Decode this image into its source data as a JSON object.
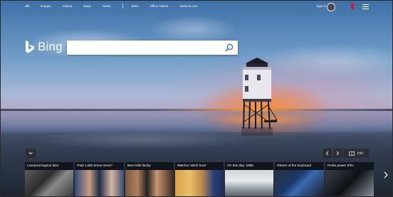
{
  "nav": {
    "links": [
      "All",
      "Images",
      "Videos",
      "Maps",
      "News",
      "MSN",
      "Office Online",
      "Outlook.com"
    ],
    "signin": "Sign in"
  },
  "brand": {
    "logo_text": "Bing"
  },
  "search": {
    "placeholder": "",
    "value": ""
  },
  "carousel": {
    "info_label": "Info",
    "cards": [
      {
        "caption": "Liverpool legend dies",
        "image": "crowd-photo"
      },
      {
        "caption": "Paid 1,500 times more?",
        "image": "two-men-photo"
      },
      {
        "caption": "Mom kills family",
        "image": "sunglasses-photo"
      },
      {
        "caption": "#MeToo 'witch hunt'",
        "image": "actress-photo"
      },
      {
        "caption": "On this day: 1985",
        "image": "vehicle-photo"
      },
      {
        "caption": "Return of the keyboard",
        "image": "phone-photo"
      },
      {
        "caption": "Probe power iPho",
        "image": "iphone-photo"
      }
    ]
  },
  "colors": {
    "accent": "#ffffff",
    "search_bg": "#ffffff"
  }
}
